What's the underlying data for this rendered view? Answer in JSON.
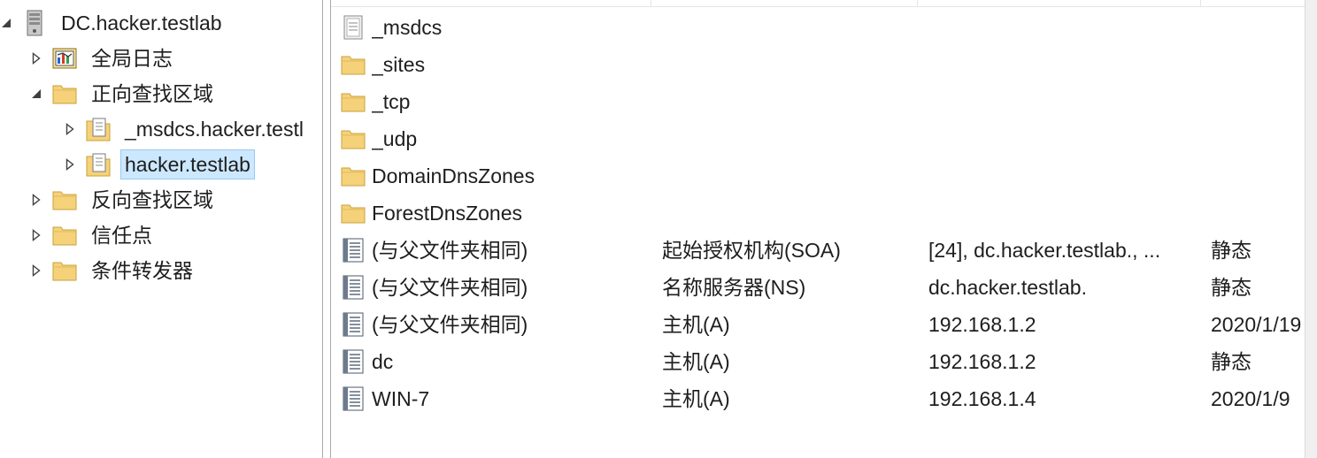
{
  "tree": {
    "server": {
      "label": "DC.hacker.testlab",
      "icon": "server-icon"
    },
    "global_logs": {
      "label": "全局日志",
      "icon": "event-log-icon"
    },
    "forward_zones": {
      "label": "正向查找区域",
      "icon": "folder-icon"
    },
    "msdcs_zone": {
      "label": "_msdcs.hacker.testl",
      "icon": "zone-file-icon"
    },
    "hacker_zone": {
      "label": "hacker.testlab",
      "icon": "zone-file-icon",
      "selected": true
    },
    "reverse_zones": {
      "label": "反向查找区域",
      "icon": "folder-icon"
    },
    "trust_points": {
      "label": "信任点",
      "icon": "folder-icon"
    },
    "conditional_forwarders": {
      "label": "条件转发器",
      "icon": "folder-icon"
    }
  },
  "list": {
    "rows": [
      {
        "name": "_msdcs",
        "type": "",
        "data": "",
        "timestamp": "",
        "icon": "zone-file-icon"
      },
      {
        "name": "_sites",
        "type": "",
        "data": "",
        "timestamp": "",
        "icon": "folder-icon"
      },
      {
        "name": "_tcp",
        "type": "",
        "data": "",
        "timestamp": "",
        "icon": "folder-icon"
      },
      {
        "name": "_udp",
        "type": "",
        "data": "",
        "timestamp": "",
        "icon": "folder-icon"
      },
      {
        "name": "DomainDnsZones",
        "type": "",
        "data": "",
        "timestamp": "",
        "icon": "folder-icon"
      },
      {
        "name": "ForestDnsZones",
        "type": "",
        "data": "",
        "timestamp": "",
        "icon": "folder-icon"
      },
      {
        "name": "(与父文件夹相同)",
        "type": "起始授权机构(SOA)",
        "data": "[24], dc.hacker.testlab., ...",
        "timestamp": "静态",
        "icon": "record-icon"
      },
      {
        "name": "(与父文件夹相同)",
        "type": "名称服务器(NS)",
        "data": "dc.hacker.testlab.",
        "timestamp": "静态",
        "icon": "record-icon"
      },
      {
        "name": "(与父文件夹相同)",
        "type": "主机(A)",
        "data": "192.168.1.2",
        "timestamp": "2020/1/19",
        "icon": "record-icon"
      },
      {
        "name": "dc",
        "type": "主机(A)",
        "data": "192.168.1.2",
        "timestamp": "静态",
        "icon": "record-icon"
      },
      {
        "name": "WIN-7",
        "type": "主机(A)",
        "data": "192.168.1.4",
        "timestamp": "2020/1/9",
        "icon": "record-icon"
      }
    ]
  },
  "colors": {
    "selection_fill": "#cce8ff",
    "selection_border": "#99c9ef",
    "folder": "#f5d27a"
  }
}
